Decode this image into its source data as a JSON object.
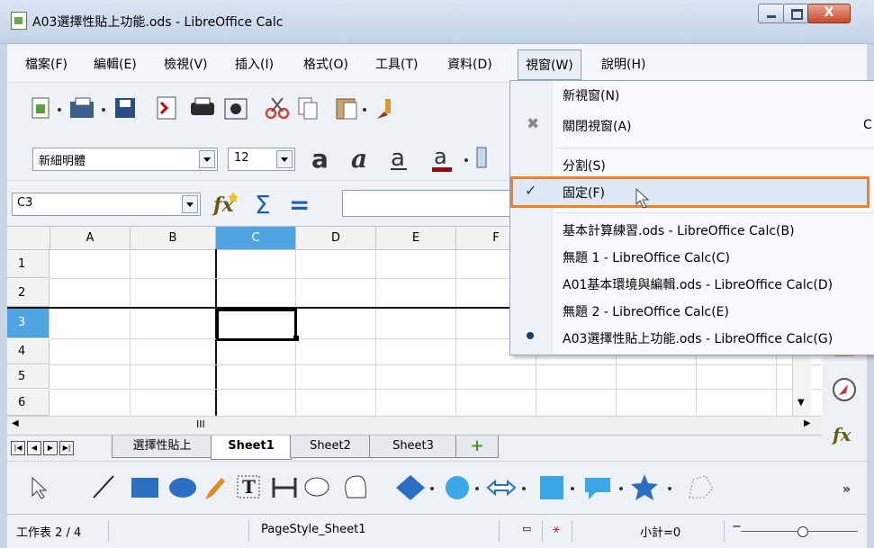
{
  "window": {
    "title": "A03選擇性貼上功能.ods - LibreOffice Calc",
    "close_glyph": "X"
  },
  "menubar": {
    "items": [
      "檔案(F)",
      "編輯(E)",
      "檢視(V)",
      "插入(I)",
      "格式(O)",
      "工具(T)",
      "資料(D)",
      "視窗(W)",
      "說明(H)"
    ],
    "open_index": 7
  },
  "format_toolbar": {
    "font_name": "新細明體",
    "font_size": "12"
  },
  "formula_bar": {
    "cell_ref": "C3"
  },
  "grid": {
    "columns": [
      "A",
      "B",
      "C",
      "D",
      "E",
      "F"
    ],
    "rows": [
      "1",
      "2",
      "3",
      "4",
      "5",
      "6"
    ],
    "selected_column": "C",
    "selected_row": "3"
  },
  "hscroll_grip": "III",
  "sheet_tabs": [
    "選擇性貼上",
    "Sheet1",
    "Sheet2",
    "Sheet3"
  ],
  "active_sheet": "Sheet1",
  "statusbar": {
    "sheet": "工作表 2 / 4",
    "page_style": "PageStyle_Sheet1",
    "sum": "小計=0"
  },
  "window_menu": {
    "new_window": "新視窗(N)",
    "close_window": "關閉視窗(A)",
    "close_window_shortcut": "C",
    "split": "分割(S)",
    "freeze": "固定(F)",
    "freeze_checked": true,
    "windows": [
      "基本計算練習.ods - LibreOffice Calc(B)",
      "無題 1 - LibreOffice Calc(C)",
      "A01基本環境與編輯.ods - LibreOffice Calc(D)",
      "無題 2 - LibreOffice Calc(E)",
      "A03選擇性貼上功能.ods - LibreOffice Calc(G)"
    ],
    "active_window_index": 4
  },
  "colors": {
    "highlight_border": "#f47f20",
    "selection": "#4fa3e0"
  }
}
